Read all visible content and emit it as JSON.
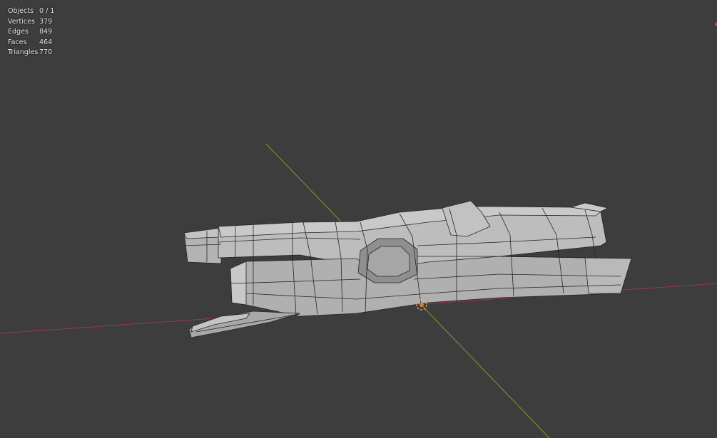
{
  "viewport": {
    "background": "#3d3d3d",
    "x_axis_color": "#9b3b44",
    "y_axis_color": "#7d9a2d",
    "mesh_face_color": "#b9b9b9",
    "mesh_wire_color": "#262626",
    "origin_icon": "object-origin-icon"
  },
  "stats": {
    "rows": [
      {
        "label": "Objects",
        "value": "0 / 1"
      },
      {
        "label": "Vertices",
        "value": "379"
      },
      {
        "label": "Edges",
        "value": "849"
      },
      {
        "label": "Faces",
        "value": "464"
      },
      {
        "label": "Triangles",
        "value": "770"
      }
    ]
  }
}
